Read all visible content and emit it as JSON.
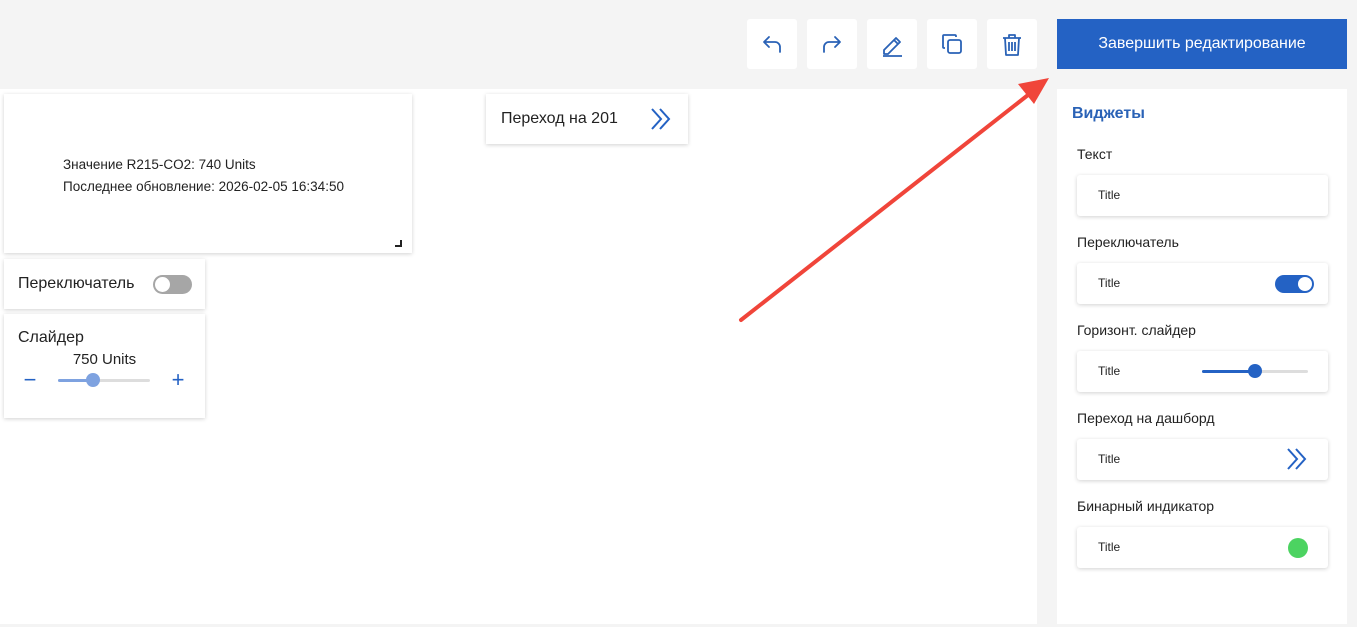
{
  "toolbar": {
    "finish_label": "Завершить редактирование",
    "icons": [
      "undo-icon",
      "redo-icon",
      "pencil-icon",
      "copy-icon",
      "trash-icon"
    ]
  },
  "canvas": {
    "text_widget": {
      "line1": "Значение R215-CO2: 740 Units",
      "line2": "Последнее обновление: 2026-02-05 16:34:50"
    },
    "nav_widget": {
      "label": "Переход на 201"
    },
    "switch_widget": {
      "label": "Переключатель",
      "on": false
    },
    "slider_widget": {
      "label": "Слайдер",
      "value_text": "750 Units",
      "minus": "−",
      "plus": "+",
      "position_fraction": 0.38
    }
  },
  "panel": {
    "title": "Виджеты",
    "sections": [
      {
        "label": "Текст",
        "card_title": "Title",
        "kind": "text"
      },
      {
        "label": "Переключатель",
        "card_title": "Title",
        "kind": "toggle",
        "on": true
      },
      {
        "label": "Горизонт. слайдер",
        "card_title": "Title",
        "kind": "slider",
        "position_fraction": 0.5
      },
      {
        "label": "Переход на дашборд",
        "card_title": "Title",
        "kind": "nav"
      },
      {
        "label": "Бинарный индикатор",
        "card_title": "Title",
        "kind": "indicator",
        "color": "#4cd361"
      }
    ]
  },
  "colors": {
    "accent": "#2462c4",
    "annotation_arrow": "#f0453a"
  }
}
